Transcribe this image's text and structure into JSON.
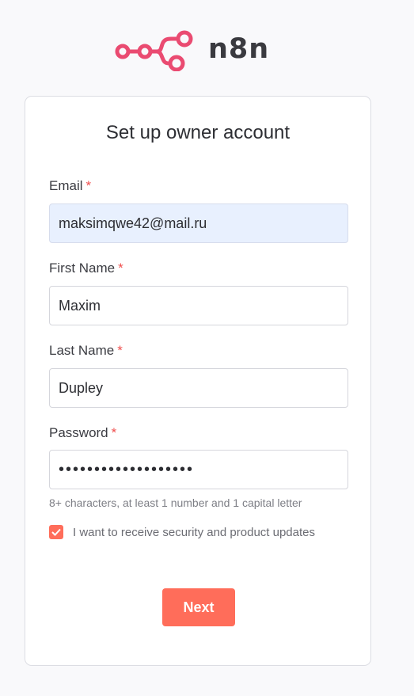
{
  "brand": {
    "name": "n8n",
    "color": "#ea4b71",
    "logo_icon": "n8n-logo-icon"
  },
  "form": {
    "title": "Set up owner account",
    "required_mark": "*",
    "fields": {
      "email": {
        "label": "Email",
        "value": "maksimqwe42@mail.ru"
      },
      "first_name": {
        "label": "First Name",
        "value": "Maxim"
      },
      "last_name": {
        "label": "Last Name",
        "value": "Dupley"
      },
      "password": {
        "label": "Password",
        "value": "•••••••••••••••••••"
      }
    },
    "password_hint": "8+ characters, at least 1 number and 1 capital letter",
    "updates_checkbox": {
      "label": "I want to receive security and product updates",
      "checked": true,
      "icon": "check-icon"
    },
    "next_label": "Next"
  },
  "colors": {
    "accent": "#ff6d5a",
    "required": "#f0504f",
    "autofill_bg": "#e8f0fe"
  }
}
